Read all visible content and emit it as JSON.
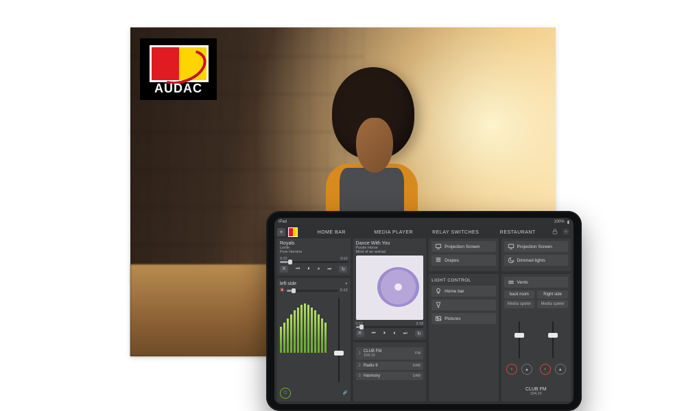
{
  "brand": "AUDAC",
  "statusbar": {
    "device": "iPad",
    "battery": "100%"
  },
  "tabs": [
    "HOME BAR",
    "MEDIA PLAYER",
    "RELAY SWITCHES",
    "RESTAURANT"
  ],
  "homebar": {
    "nowplaying": {
      "title": "Royals",
      "artist": "Lorde",
      "album": "Pure Heroine",
      "elapsed": "0:22",
      "total": "3:10",
      "progress": 12
    },
    "zone_label": "left side",
    "level_text": "0.10",
    "meter_heights": [
      38,
      44,
      50,
      56,
      62,
      66,
      70,
      72,
      70,
      66,
      62,
      56,
      50,
      44
    ],
    "power": "on"
  },
  "mediaplayer": {
    "track": {
      "title": "Dance With You",
      "artist": "Purple Horse",
      "album": "Mind of an animal",
      "elapsed": "0:11",
      "total": "3:18",
      "progress": 6
    }
  },
  "relays": {
    "items": [
      {
        "label": "Projection Screen",
        "icon": "monitor"
      },
      {
        "label": "Drapes",
        "icon": "blinds"
      }
    ],
    "relays2": [
      {
        "label": "Projection Screen",
        "icon": "monitor"
      },
      {
        "label": "Dimmed lights",
        "icon": "moon"
      }
    ],
    "light_section": "LIGHT CONTROL",
    "light_items": [
      {
        "label": "Home bar",
        "icon": "bulb"
      },
      {
        "label": "",
        "icon": "glass"
      },
      {
        "label": "Pictures",
        "icon": "image"
      }
    ],
    "stations": [
      {
        "name": "CLUB FM",
        "freq": "104,10",
        "band": "FM"
      },
      {
        "name": "Radio 9",
        "band": "DAB"
      },
      {
        "name": "Harmony",
        "band": "DAB"
      }
    ]
  },
  "restaurant": {
    "vents": "Vents",
    "zones": [
      {
        "name": "back room",
        "source": "Media speler",
        "fader": 35
      },
      {
        "name": "Right side",
        "source": "Media speler",
        "fader": 35
      }
    ],
    "tuned": {
      "name": "CLUB FM",
      "freq": "104,10"
    }
  }
}
